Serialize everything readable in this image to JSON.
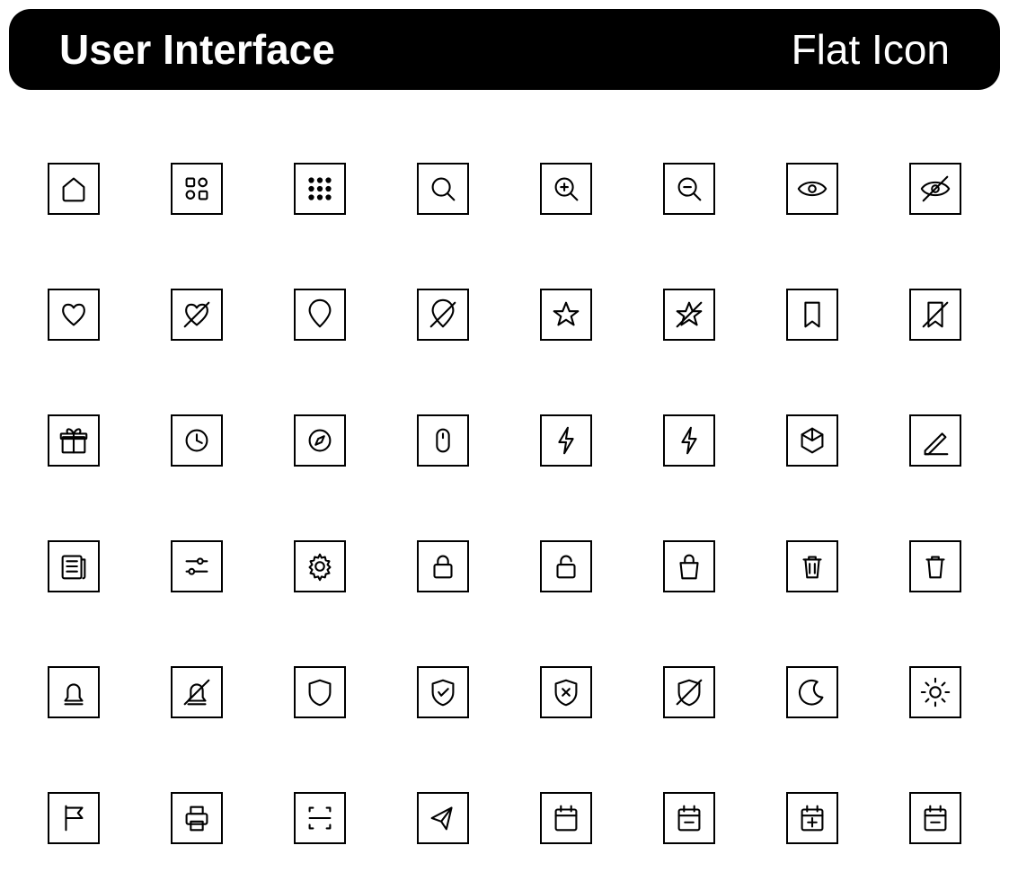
{
  "header": {
    "title": "User Interface",
    "subtitle": "Flat Icon"
  },
  "icons": [
    "home",
    "apps",
    "grid-dots",
    "search",
    "zoom-in",
    "zoom-out",
    "eye",
    "eye-off",
    "heart",
    "heart-off",
    "pin",
    "pin-off",
    "star",
    "star-off",
    "bookmark",
    "bookmark-off",
    "gift",
    "clock",
    "compass",
    "mouse",
    "flash",
    "flash-bolt",
    "cube",
    "edit",
    "news",
    "sliders",
    "gear",
    "lock",
    "unlock",
    "bag",
    "trash",
    "trash-alt",
    "bell",
    "bell-off",
    "shield",
    "shield-check",
    "shield-x",
    "shield-off",
    "moon",
    "sun",
    "flag",
    "printer",
    "scan",
    "send",
    "calendar",
    "calendar-minus",
    "calendar-plus",
    "calendar-remove"
  ]
}
